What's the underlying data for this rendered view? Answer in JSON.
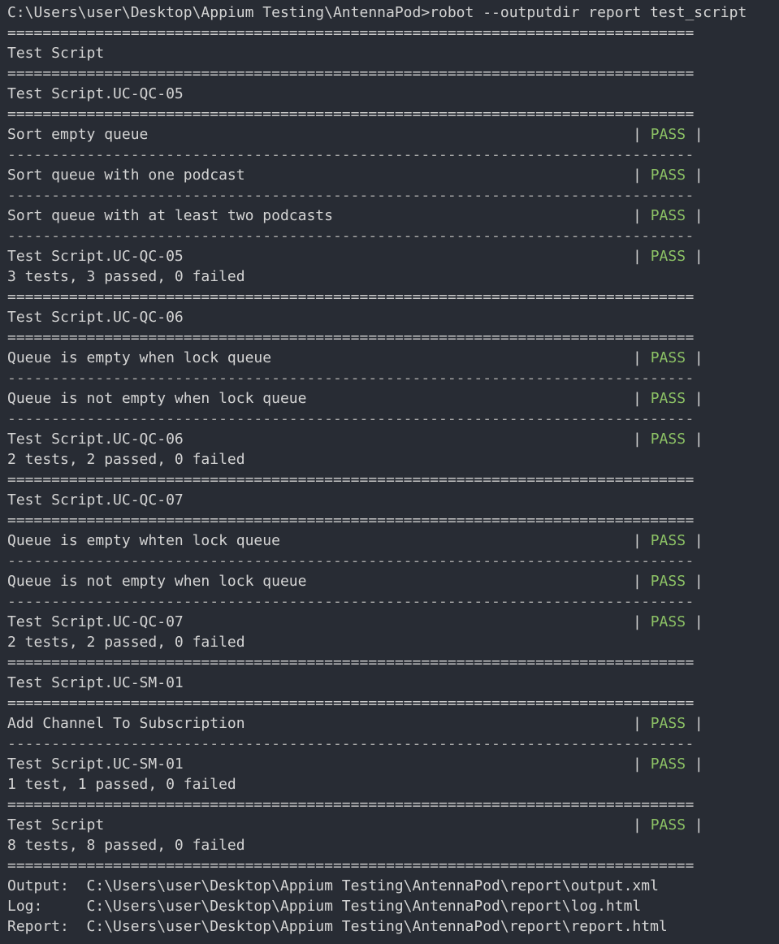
{
  "terminal": {
    "command_line": "C:\\Users\\user\\Desktop\\Appium Testing\\AntennaPod>robot --outputdir report test_script",
    "eq_separator": "==============================================================================",
    "dash_separator": "------------------------------------------------------------------------------",
    "status_label": "PASS",
    "status_bar": "|",
    "lines": [
      {
        "type": "eq"
      },
      {
        "type": "text",
        "text": "Test Script"
      },
      {
        "type": "eq"
      },
      {
        "type": "text",
        "text": "Test Script.UC-QC-05"
      },
      {
        "type": "eq"
      },
      {
        "type": "test",
        "text": "Sort empty queue",
        "status": "PASS"
      },
      {
        "type": "dash"
      },
      {
        "type": "test",
        "text": "Sort queue with one podcast",
        "status": "PASS"
      },
      {
        "type": "dash"
      },
      {
        "type": "test",
        "text": "Sort queue with at least two podcasts",
        "status": "PASS"
      },
      {
        "type": "dash"
      },
      {
        "type": "test",
        "text": "Test Script.UC-QC-05",
        "status": "PASS"
      },
      {
        "type": "text",
        "text": "3 tests, 3 passed, 0 failed"
      },
      {
        "type": "eq"
      },
      {
        "type": "text",
        "text": "Test Script.UC-QC-06"
      },
      {
        "type": "eq"
      },
      {
        "type": "test",
        "text": "Queue is empty when lock queue",
        "status": "PASS"
      },
      {
        "type": "dash"
      },
      {
        "type": "test",
        "text": "Queue is not empty when lock queue",
        "status": "PASS"
      },
      {
        "type": "dash"
      },
      {
        "type": "test",
        "text": "Test Script.UC-QC-06",
        "status": "PASS"
      },
      {
        "type": "text",
        "text": "2 tests, 2 passed, 0 failed"
      },
      {
        "type": "eq"
      },
      {
        "type": "text",
        "text": "Test Script.UC-QC-07"
      },
      {
        "type": "eq"
      },
      {
        "type": "test",
        "text": "Queue is empty whten lock queue",
        "status": "PASS"
      },
      {
        "type": "dash"
      },
      {
        "type": "test",
        "text": "Queue is not empty when lock queue",
        "status": "PASS"
      },
      {
        "type": "dash"
      },
      {
        "type": "test",
        "text": "Test Script.UC-QC-07",
        "status": "PASS"
      },
      {
        "type": "text",
        "text": "2 tests, 2 passed, 0 failed"
      },
      {
        "type": "eq"
      },
      {
        "type": "text",
        "text": "Test Script.UC-SM-01"
      },
      {
        "type": "eq"
      },
      {
        "type": "test",
        "text": "Add Channel To Subscription",
        "status": "PASS"
      },
      {
        "type": "dash"
      },
      {
        "type": "test",
        "text": "Test Script.UC-SM-01",
        "status": "PASS"
      },
      {
        "type": "text",
        "text": "1 test, 1 passed, 0 failed"
      },
      {
        "type": "eq"
      },
      {
        "type": "test",
        "text": "Test Script",
        "status": "PASS"
      },
      {
        "type": "text",
        "text": "8 tests, 8 passed, 0 failed"
      },
      {
        "type": "eq"
      },
      {
        "type": "text",
        "text": "Output:  C:\\Users\\user\\Desktop\\Appium Testing\\AntennaPod\\report\\output.xml"
      },
      {
        "type": "text",
        "text": "Log:     C:\\Users\\user\\Desktop\\Appium Testing\\AntennaPod\\report\\log.html"
      },
      {
        "type": "text",
        "text": "Report:  C:\\Users\\user\\Desktop\\Appium Testing\\AntennaPod\\report\\report.html"
      }
    ]
  },
  "colors": {
    "background": "#282c34",
    "text": "#d4d4d4",
    "pass": "#8cc265"
  }
}
